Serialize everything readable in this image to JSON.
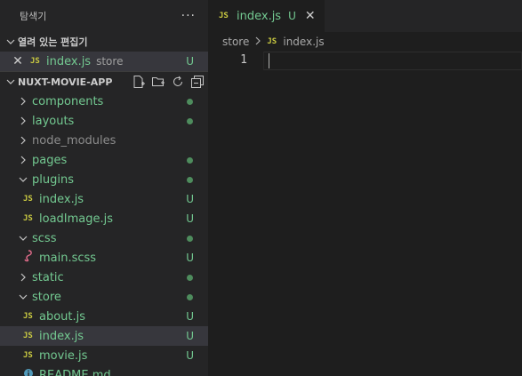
{
  "sidebar": {
    "title": "탐색기",
    "more": "···",
    "open_editors": {
      "label": "열려 있는 편집기",
      "items": [
        {
          "icon": "JS",
          "name": "index.js",
          "desc": "store",
          "status": "U"
        }
      ]
    },
    "project": {
      "label": "NUXT-MOVIE-APP",
      "tree": [
        {
          "type": "folder",
          "name": "components",
          "expanded": false,
          "marker": "dot"
        },
        {
          "type": "folder",
          "name": "layouts",
          "expanded": false,
          "marker": "dot"
        },
        {
          "type": "folder",
          "name": "node_modules",
          "expanded": false,
          "marker": ""
        },
        {
          "type": "folder",
          "name": "pages",
          "expanded": false,
          "marker": "dot"
        },
        {
          "type": "folder",
          "name": "plugins",
          "expanded": true,
          "marker": "dot"
        },
        {
          "type": "file",
          "icon": "JS",
          "name": "index.js",
          "status": "U"
        },
        {
          "type": "file",
          "icon": "JS",
          "name": "loadImage.js",
          "status": "U"
        },
        {
          "type": "folder",
          "name": "scss",
          "expanded": true,
          "marker": "dot"
        },
        {
          "type": "file",
          "icon": "scss",
          "name": "main.scss",
          "status": "U"
        },
        {
          "type": "folder",
          "name": "static",
          "expanded": false,
          "marker": "dot"
        },
        {
          "type": "folder",
          "name": "store",
          "expanded": true,
          "marker": "dot"
        },
        {
          "type": "file",
          "icon": "JS",
          "name": "about.js",
          "status": "U"
        },
        {
          "type": "file",
          "icon": "JS",
          "name": "index.js",
          "status": "U",
          "selected": true
        },
        {
          "type": "file",
          "icon": "JS",
          "name": "movie.js",
          "status": "U"
        },
        {
          "type": "file",
          "icon": "info",
          "name": "README.md",
          "status": ""
        }
      ]
    }
  },
  "editor": {
    "tab": {
      "icon": "JS",
      "name": "index.js",
      "status": "U",
      "close": "✕"
    },
    "breadcrumb": {
      "folder": "store",
      "icon": "JS",
      "file": "index.js"
    },
    "line_number": "1"
  },
  "colors": {
    "untracked": "#73c991",
    "js_badge": "#cbcb41",
    "sidebar_bg": "#252526",
    "editor_bg": "#1e1e1e"
  }
}
